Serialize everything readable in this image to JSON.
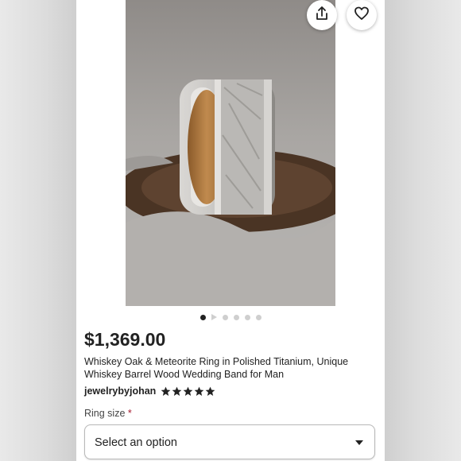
{
  "listing": {
    "price": "$1,369.00",
    "title": "Whiskey Oak & Meteorite Ring in Polished Titanium, Unique Whiskey Barrel Wood Wedding Band for Man",
    "seller": "jewelrybyjohan",
    "rating": 5,
    "rating_max": 5
  },
  "gallery": {
    "dot_count": 6,
    "active_index": 0
  },
  "icons": {
    "share": "share-icon",
    "favorite": "heart-icon",
    "star": "star-icon",
    "caret": "chevron-down-icon"
  },
  "ring_size": {
    "label": "Ring size",
    "required_mark": "*",
    "select_value": "Select an option"
  },
  "colors": {
    "required": "#a61a2e",
    "active_dot": "#222222",
    "inactive_dot": "#cfcfcf"
  }
}
